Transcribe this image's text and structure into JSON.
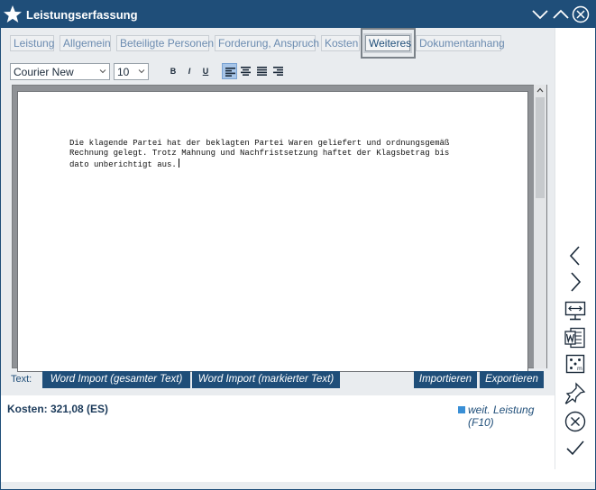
{
  "window": {
    "title": "Leistungserfassung"
  },
  "tabs": [
    {
      "label": "Leistung"
    },
    {
      "label": "Allgemein"
    },
    {
      "label": "Beteiligte Personen"
    },
    {
      "label": "Forderung, Anspruch"
    },
    {
      "label": "Kosten"
    },
    {
      "label": "Weiteres",
      "active": true
    },
    {
      "label": "Dokumentanhang"
    }
  ],
  "toolbar": {
    "font": "Courier New",
    "size": "10",
    "bold": "B",
    "italic": "I",
    "underline": "U",
    "align_selected": "left"
  },
  "editor": {
    "text": "Die klagende Partei hat der beklagten Partei Waren geliefert und ordnungsgemäß\nRechnung gelegt. Trotz Mahnung und Nachfristsetzung haftet der Klagsbetrag bis\ndato unberichtigt aus."
  },
  "textbar": {
    "label": "Text:",
    "word_import_all": "Word Import (gesamter Text)",
    "word_import_selected": "Word Import (markierter Text)",
    "import": "Importieren",
    "export": "Exportieren"
  },
  "status": {
    "kosten": "Kosten: 321,08 (ES)",
    "weit_leistung": "weit. Leistung (F10)"
  },
  "colors": {
    "titlebar": "#1f4e79",
    "accent": "#3a8fd6",
    "button": "#1f4e79"
  },
  "sidebar_icons": [
    "chevron-left-icon",
    "chevron-right-icon",
    "fit-width-icon",
    "word-icon",
    "dice-icon",
    "pin-icon",
    "cancel-icon",
    "check-icon"
  ]
}
